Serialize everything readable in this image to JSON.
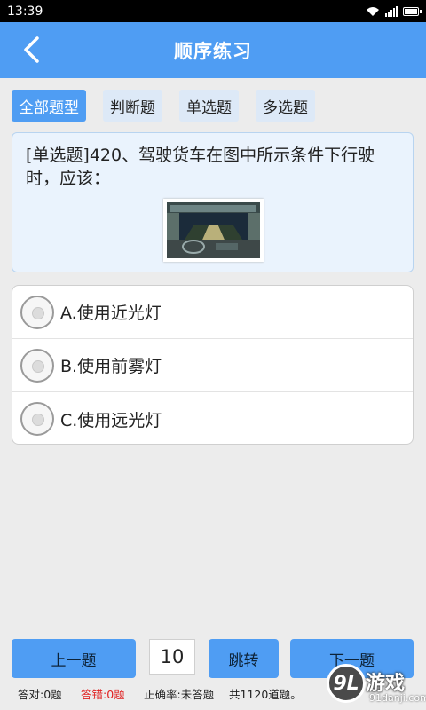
{
  "status_bar": {
    "time": "13:39"
  },
  "header": {
    "title": "顺序练习"
  },
  "tabs": [
    {
      "label": "全部题型",
      "active": true
    },
    {
      "label": "判断题",
      "active": false
    },
    {
      "label": "单选题",
      "active": false
    },
    {
      "label": "多选题",
      "active": false
    }
  ],
  "question": {
    "text": "[单选题]420、驾驶货车在图中所示条件下行驶时，应该："
  },
  "options": [
    {
      "label": "A.使用近光灯"
    },
    {
      "label": "B.使用前雾灯"
    },
    {
      "label": "C.使用远光灯"
    }
  ],
  "footer": {
    "prev_label": "上一题",
    "page_value": "10",
    "jump_label": "跳转",
    "next_label": "下一题",
    "correct": "答对:0题",
    "wrong": "答错:0题",
    "rate": "正确率:未答题",
    "total": "共1120道题。"
  },
  "watermark": {
    "logo": "9L",
    "text": "游戏",
    "domain": "91danji.com"
  },
  "colors": {
    "accent": "#4f9df3",
    "wrong": "#e02020"
  }
}
